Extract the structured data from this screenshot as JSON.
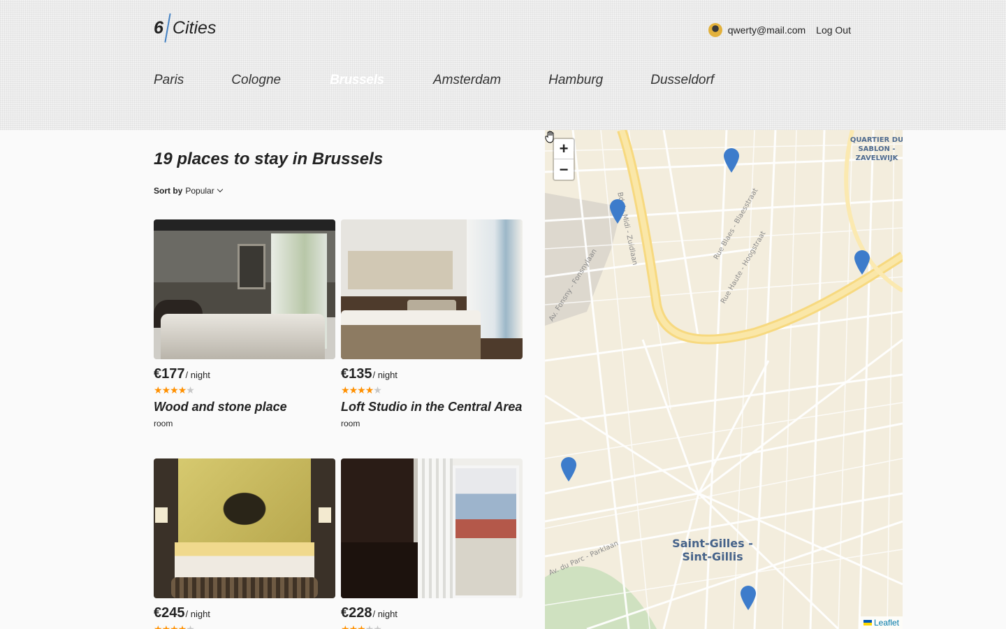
{
  "header": {
    "logo_six": "6",
    "logo_cities": "Cities",
    "user_email": "qwerty@mail.com",
    "logout_label": "Log Out"
  },
  "tabs": [
    {
      "label": "Paris",
      "active": false
    },
    {
      "label": "Cologne",
      "active": false
    },
    {
      "label": "Brussels",
      "active": true
    },
    {
      "label": "Amsterdam",
      "active": false
    },
    {
      "label": "Hamburg",
      "active": false
    },
    {
      "label": "Dusseldorf",
      "active": false
    }
  ],
  "main": {
    "title": "19 places to stay in Brussels",
    "sort_label": "Sort by",
    "sort_value": "Popular"
  },
  "offers": [
    {
      "price": "€177",
      "per": "/ night",
      "rating": 4,
      "name": "Wood and stone place",
      "type": "room"
    },
    {
      "price": "€135",
      "per": "/ night",
      "rating": 4,
      "name": "Loft Studio in the Central Area",
      "type": "room"
    },
    {
      "price": "€245",
      "per": "/ night",
      "rating": 4,
      "name": "",
      "type": ""
    },
    {
      "price": "€228",
      "per": "/ night",
      "rating": 3,
      "name": "",
      "type": ""
    }
  ],
  "map": {
    "zoom_in": "+",
    "zoom_out": "−",
    "attribution": "Leaflet",
    "district_line1": "Saint-Gilles -",
    "district_line2": "Sint-Gillis",
    "quarter_line1": "QUARTIER DU",
    "quarter_line2": "SABLON -",
    "quarter_line3": "ZAVELWIJK",
    "streets": {
      "bd_du_midi": "Bd du Midi - Zuidlaan",
      "fonsny": "Av. Fonsny - Fonsnylaan",
      "blaes": "Rue Blaes - Blaesstraat",
      "haute": "Rue Haute - Hoogstraat",
      "parc": "Av. du Parc - Parklaan"
    },
    "pin_color": "#3d7ccb"
  },
  "colors": {
    "accent": "#4481c3",
    "star_on": "#ff9000",
    "star_off": "#c7c7c7"
  }
}
